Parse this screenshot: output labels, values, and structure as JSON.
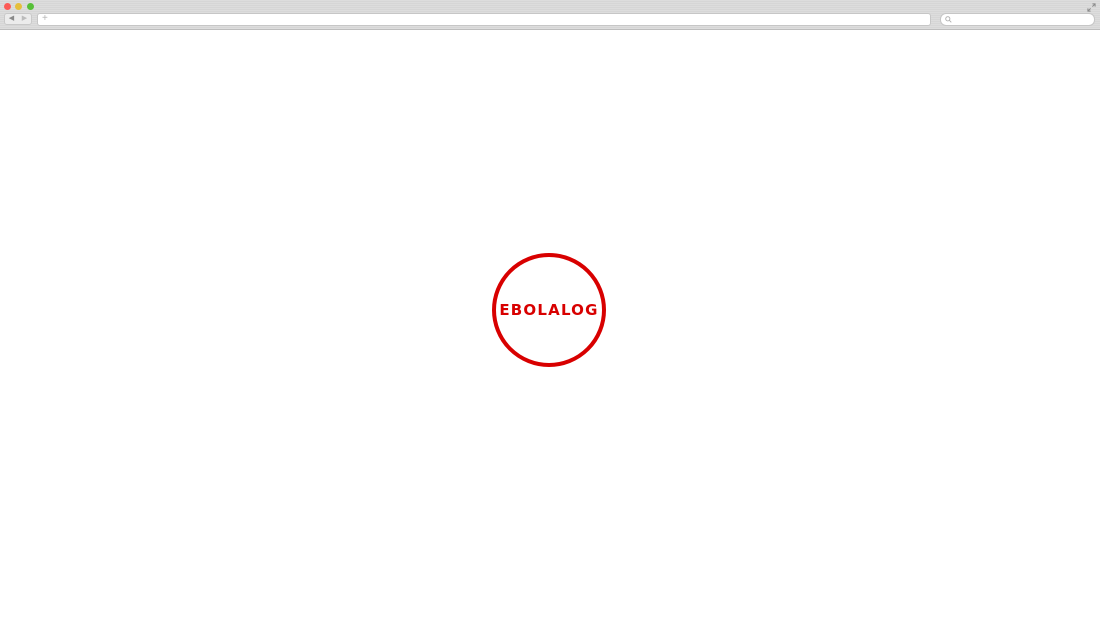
{
  "browser": {
    "back_icon": "back-arrow-icon",
    "forward_icon": "forward-arrow-icon",
    "new_tab_symbol": "+",
    "address_value": "",
    "search_value": "",
    "colors": {
      "close": "#fc5b57",
      "minimize": "#e5bf3c",
      "maximize": "#57c038"
    }
  },
  "page": {
    "logo_text": "EBOLALOG",
    "accent_color": "#d80000"
  }
}
